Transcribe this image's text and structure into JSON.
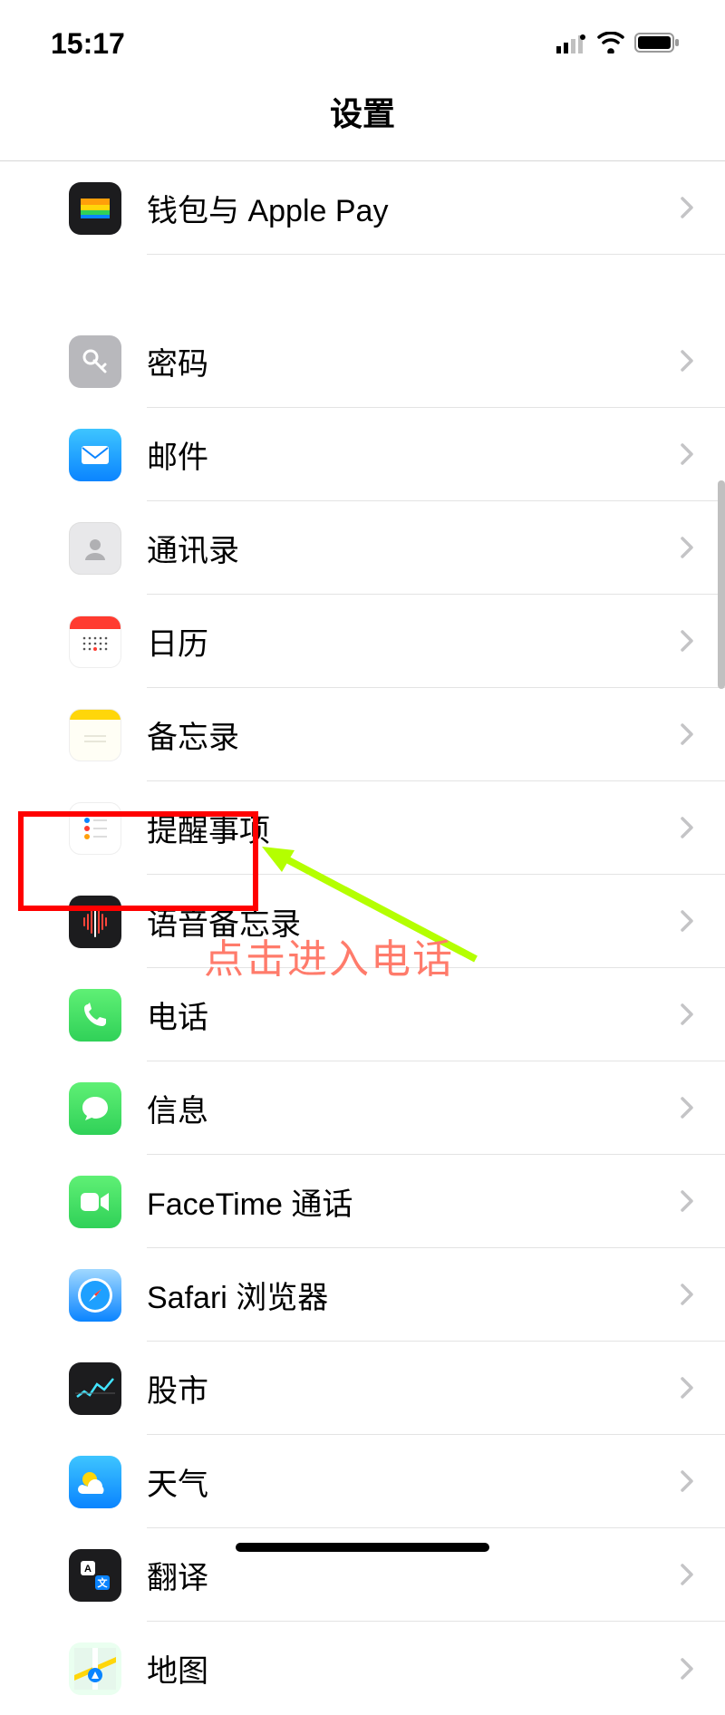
{
  "status": {
    "time": "15:17"
  },
  "header": {
    "title": "设置"
  },
  "annotation": {
    "text": "点击进入电话"
  },
  "groups": [
    {
      "items": [
        {
          "id": "wallet",
          "label": "钱包与 Apple Pay"
        }
      ]
    },
    {
      "items": [
        {
          "id": "passwords",
          "label": "密码"
        },
        {
          "id": "mail",
          "label": "邮件"
        },
        {
          "id": "contacts",
          "label": "通讯录"
        },
        {
          "id": "calendar",
          "label": "日历"
        },
        {
          "id": "notes",
          "label": "备忘录"
        },
        {
          "id": "reminders",
          "label": "提醒事项"
        },
        {
          "id": "voice",
          "label": "语音备忘录"
        },
        {
          "id": "phone",
          "label": "电话"
        },
        {
          "id": "messages",
          "label": "信息"
        },
        {
          "id": "facetime",
          "label": "FaceTime 通话"
        },
        {
          "id": "safari",
          "label": "Safari 浏览器"
        },
        {
          "id": "stocks",
          "label": "股市"
        },
        {
          "id": "weather",
          "label": "天气"
        },
        {
          "id": "translate",
          "label": "翻译"
        },
        {
          "id": "maps",
          "label": "地图"
        }
      ]
    }
  ]
}
